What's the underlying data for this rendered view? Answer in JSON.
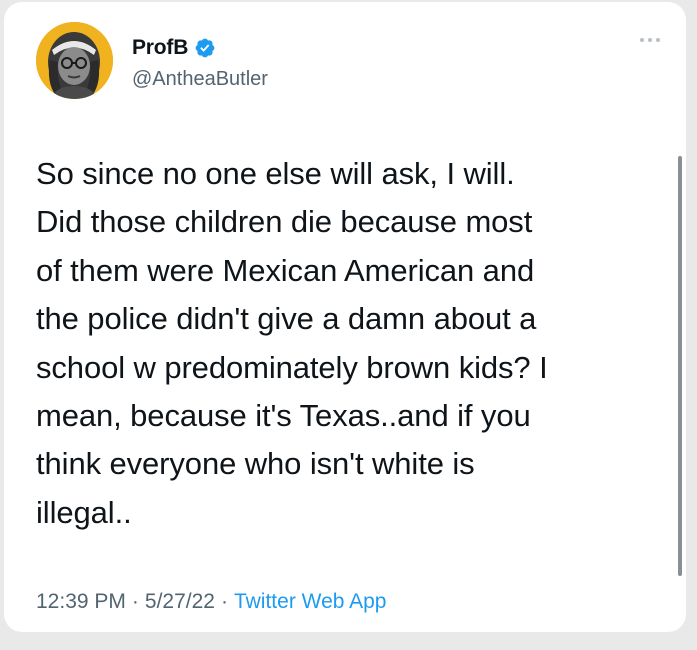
{
  "author": {
    "display_name": "ProfB",
    "handle": "@AntheaButler",
    "verified": true,
    "avatar_icon": "profile-avatar-illustration",
    "avatar_bg": "#f0b21e"
  },
  "tweet": {
    "text": "So since no one else will ask, I will.\nDid those children die because most\nof them were Mexican American and\nthe police didn't give a damn about a\nschool w predominately brown kids? I\nmean, because it's Texas..and if you\nthink everyone who isn't white is\nillegal..",
    "time": "12:39 PM",
    "date": "5/27/22",
    "source": "Twitter Web App",
    "separator": "·"
  },
  "icons": {
    "verified": "verified-badge-icon",
    "more": "more-options-icon"
  },
  "colors": {
    "verified_blue": "#1d9bf0",
    "text_primary": "#0f1419",
    "text_secondary": "#536471"
  }
}
